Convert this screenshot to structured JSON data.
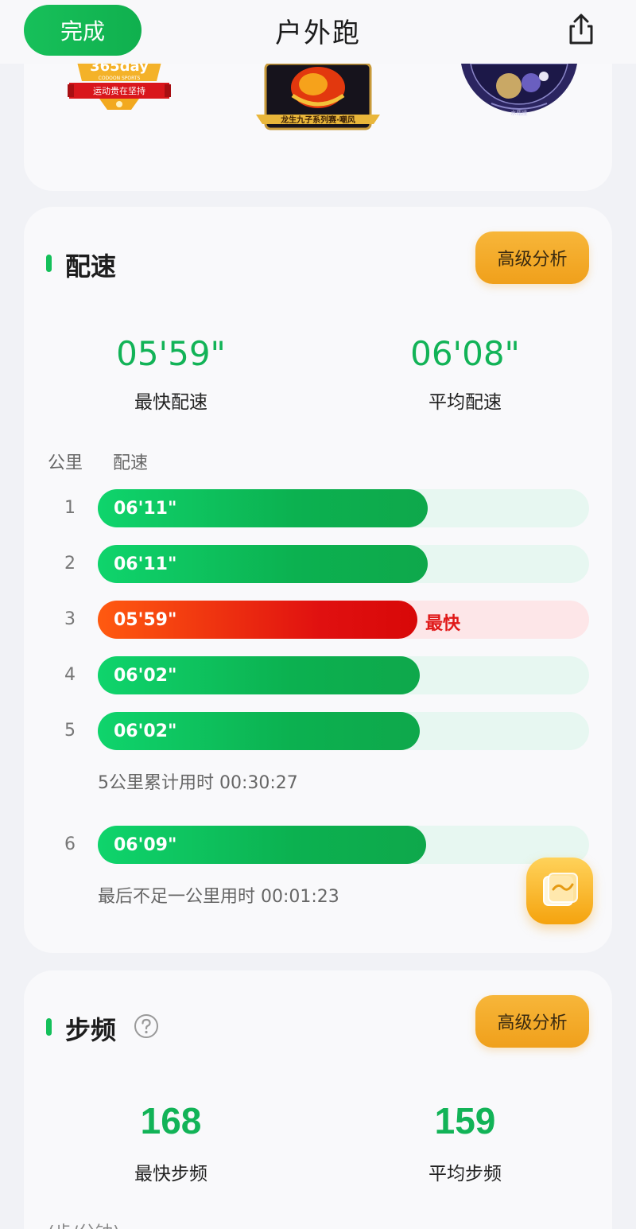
{
  "header": {
    "done_label": "完成",
    "title": "户外跑",
    "share_icon": "share-icon"
  },
  "medals": [
    {
      "name": "365day-medal",
      "line1": "365day",
      "line2": "CODOON SPORTS",
      "line3": "运动贵在坚持"
    },
    {
      "name": "dragon-medal",
      "caption": "龙生九子系列赛·嘲风"
    },
    {
      "name": "constellation-medal",
      "caption": "水瓶座"
    }
  ],
  "pace": {
    "title": "配速",
    "advanced_label": "高级分析",
    "fastest_value": "05'59\"",
    "fastest_label": "最快配速",
    "average_value": "06'08\"",
    "average_label": "平均配速",
    "col_km": "公里",
    "col_pace": "配速",
    "fastest_tag": "最快",
    "cumulative_note": "5公里累计用时 00:30:27",
    "last_note": "最后不足一公里用时 00:01:23",
    "rows": [
      {
        "km": "1",
        "pace": "06'11\"",
        "fill": 0.672,
        "fastest": false
      },
      {
        "km": "2",
        "pace": "06'11\"",
        "fill": 0.672,
        "fastest": false
      },
      {
        "km": "3",
        "pace": "05'59\"",
        "fill": 0.65,
        "fastest": true
      },
      {
        "km": "4",
        "pace": "06'02\"",
        "fill": 0.655,
        "fastest": false
      },
      {
        "km": "5",
        "pace": "06'02\"",
        "fill": 0.655,
        "fastest": false
      },
      {
        "km": "6",
        "pace": "06'09\"",
        "fill": 0.669,
        "fastest": false
      }
    ]
  },
  "cadence": {
    "title": "步频",
    "advanced_label": "高级分析",
    "fastest_value": "168",
    "fastest_label": "最快步频",
    "average_value": "159",
    "average_label": "平均步频",
    "unit_label": "(步/分钟)"
  },
  "colors": {
    "green": "#12b357",
    "orange": "#f0a01b",
    "red": "#e01010"
  }
}
